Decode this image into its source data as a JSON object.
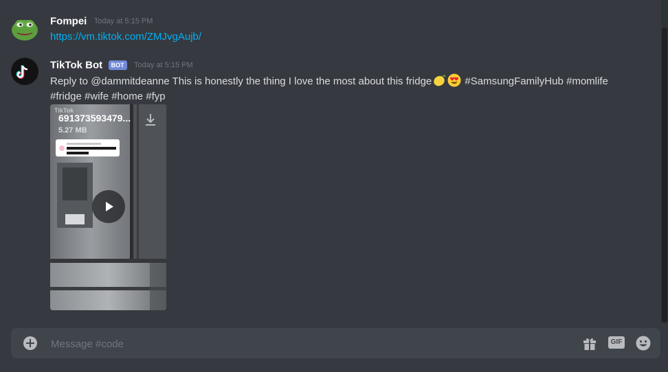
{
  "messages": [
    {
      "author": "Fompei",
      "timestamp": "Today at 5:15 PM",
      "link": "https://vm.tiktok.com/ZMJvgAujb/"
    },
    {
      "author": "TikTok Bot",
      "bot_tag": "BOT",
      "timestamp": "Today at 5:15 PM",
      "text_before": "Reply to @dammitdeanne This is honestly the thing I love the most about this fridge",
      "text_after": " #SamsungFamilyHub #momlife #fridge #wife #home #fyp",
      "emojis": [
        "lemon-emoji",
        "heart-eyes-emoji"
      ],
      "attachment": {
        "watermark": "TikTok",
        "filename": "691373593479...",
        "size": "5.27 MB",
        "reply_card": "What was that water thing at the end?"
      }
    }
  ],
  "composer": {
    "placeholder": "Message #code",
    "gif_label": "GIF"
  },
  "colors": {
    "background": "#36393f",
    "link": "#00b0f4",
    "bot_tag": "#7289da",
    "composer": "#40444b"
  }
}
